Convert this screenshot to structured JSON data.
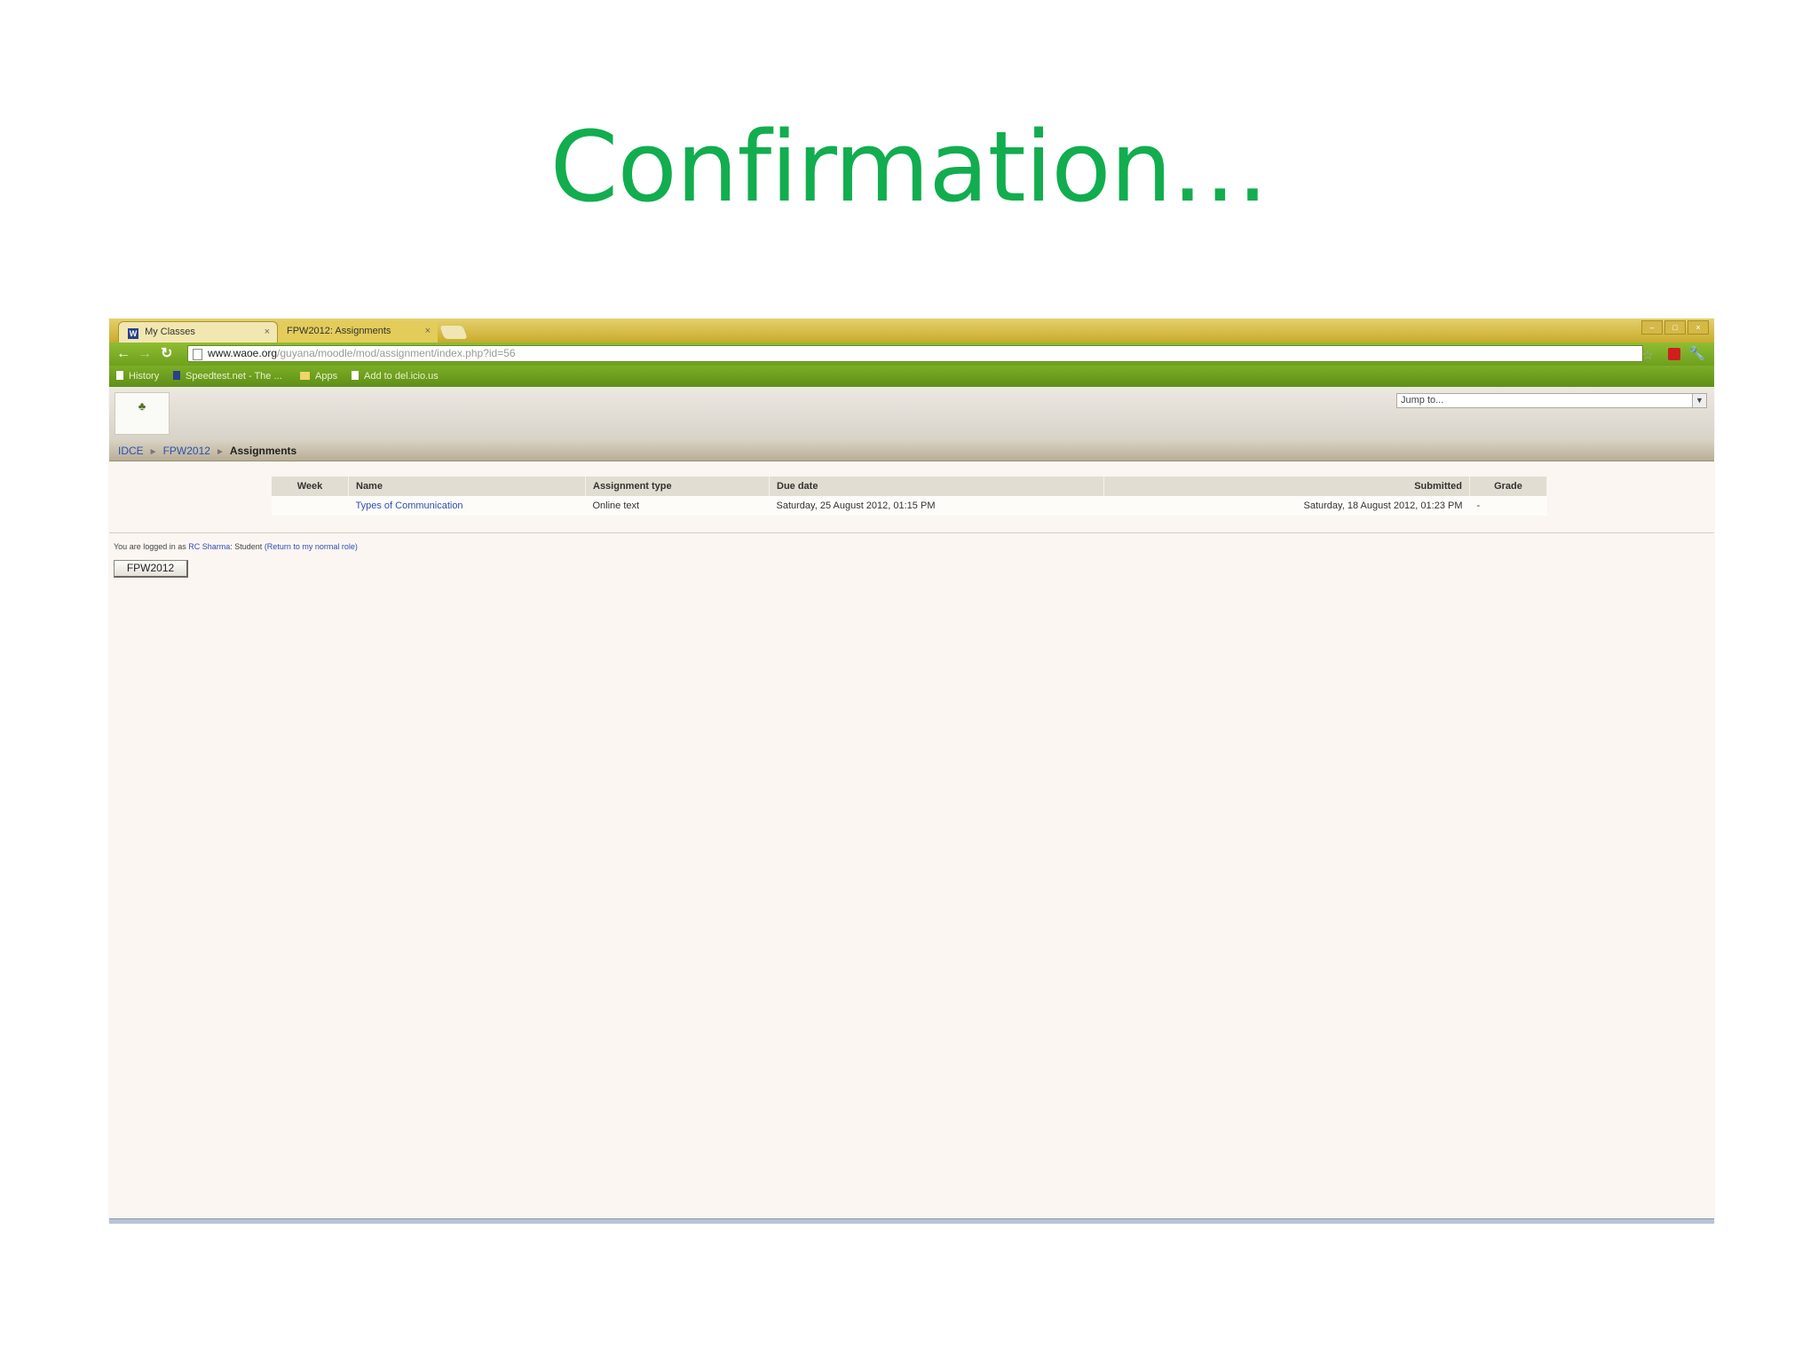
{
  "slide": {
    "title": "Confirmation…"
  },
  "browser": {
    "tabs": [
      {
        "label": "My Classes",
        "icon": "W"
      },
      {
        "label": "FPW2012: Assignments"
      }
    ],
    "url_domain": "www.waoe.org",
    "url_path": "/guyana/moodle/mod/assignment/index.php?id=56",
    "bookmarks": [
      {
        "label": "History"
      },
      {
        "label": "Speedtest.net - The ..."
      },
      {
        "label": "Apps"
      },
      {
        "label": "Add to del.icio.us"
      }
    ]
  },
  "moodle": {
    "jump_placeholder": "Jump to...",
    "breadcrumb": {
      "root": "IDCE",
      "course": "FPW2012",
      "current": "Assignments"
    },
    "table": {
      "headers": {
        "week": "Week",
        "name": "Name",
        "type": "Assignment type",
        "due": "Due date",
        "submitted": "Submitted",
        "grade": "Grade"
      },
      "rows": [
        {
          "week": "",
          "name": "Types of Communication",
          "type": "Online text",
          "due": "Saturday, 25 August 2012, 01:15 PM",
          "submitted": "Saturday, 18 August 2012, 01:23 PM",
          "grade": "-"
        }
      ]
    },
    "login_prefix": "You are logged in as",
    "login_user": "RC Sharma",
    "login_role": ": Student",
    "login_return": "(Return to my normal role)",
    "course_button": "FPW2012"
  },
  "colors": {
    "title_green": "#12ad4f",
    "chrome_green": "#7cae27",
    "link_blue": "#2d4fb3"
  }
}
